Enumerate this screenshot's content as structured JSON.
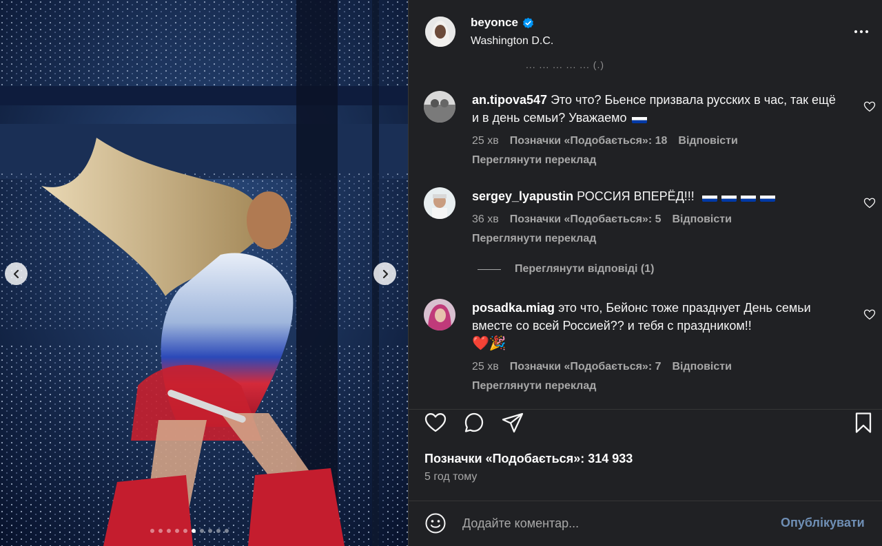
{
  "post": {
    "username": "beyonce",
    "location": "Washington D.C.",
    "hidden_line": "... ... ... ... ... (.)",
    "likes_text": "Позначки «Подобається»: 314 933",
    "time_ago": "5 год тому"
  },
  "carousel": {
    "total": 10,
    "active_index": 5
  },
  "comments": [
    {
      "username": "an.tipova547",
      "text": "Это что? Бьенсе призвала русских в час, так ещё и в день семьи? Уважаемо",
      "flags": 1,
      "time": "25 хв",
      "likes": "Позначки «Подобається»: 18",
      "reply": "Відповісти",
      "translate": "Переглянути переклад"
    },
    {
      "username": "sergey_lyapustin",
      "text": "РОССИЯ ВПЕРЁД!!!",
      "flags": 4,
      "time": "36 хв",
      "likes": "Позначки «Подобається»: 5",
      "reply": "Відповісти",
      "translate": "Переглянути переклад"
    },
    {
      "username": "posadka.miag",
      "text": "это что, Бейонс тоже празднует День семьи вместе со всей Россией?? и тебя с праздником!!",
      "emoji": "❤️🎉",
      "time": "25 хв",
      "likes": "Позначки «Подобається»: 7",
      "reply": "Відповісти",
      "translate": "Переглянути переклад"
    }
  ],
  "view_replies": "Переглянути відповіді (1)",
  "composer": {
    "placeholder": "Додайте коментар...",
    "publish_label": "Опублікувати"
  },
  "colors": {
    "panel_bg": "#202124",
    "muted_text": "#a8a8a8",
    "verified": "#0095f6",
    "publish_disabled": "#6f8fb5"
  }
}
